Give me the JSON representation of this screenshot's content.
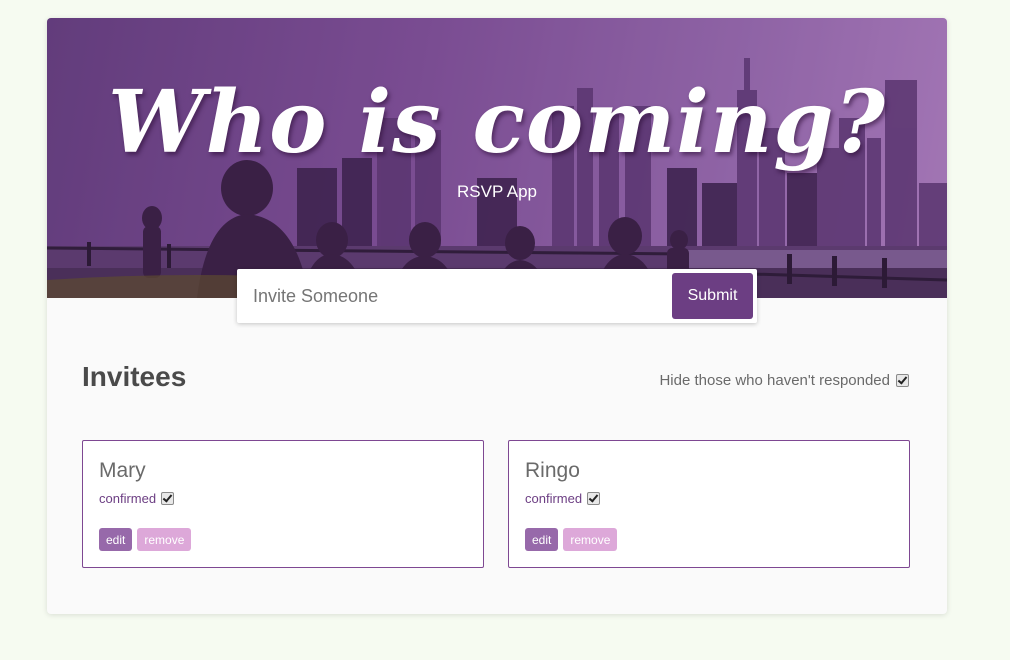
{
  "header": {
    "title": "Who is coming?",
    "subtitle": "RSVP App"
  },
  "invite_form": {
    "placeholder": "Invite Someone",
    "value": "",
    "submit_label": "Submit"
  },
  "invitees_section": {
    "title": "Invitees",
    "filter_label": "Hide those who haven't responded",
    "filter_checked": true
  },
  "invitees": [
    {
      "name": "Mary",
      "status_label": "confirmed",
      "confirmed": true,
      "edit_label": "edit",
      "remove_label": "remove"
    },
    {
      "name": "Ringo",
      "status_label": "confirmed",
      "confirmed": true,
      "edit_label": "edit",
      "remove_label": "remove"
    }
  ],
  "colors": {
    "brand_purple": "#6c3e83",
    "edit_button": "#9769aa",
    "remove_button": "#dda8d9",
    "card_border": "#7e4892",
    "page_background": "#f6fbf1"
  }
}
